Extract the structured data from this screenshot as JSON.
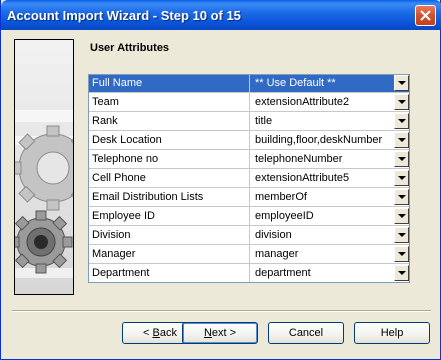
{
  "window": {
    "title": "Account Import Wizard - Step 10 of 15"
  },
  "page": {
    "section_title": "User Attributes"
  },
  "attributes": {
    "rows": [
      {
        "name": "Full Name",
        "value": "** Use Default **"
      },
      {
        "name": "Team",
        "value": "extensionAttribute2"
      },
      {
        "name": "Rank",
        "value": "title"
      },
      {
        "name": "Desk Location",
        "value": "building,floor,deskNumber"
      },
      {
        "name": "Telephone no",
        "value": "telephoneNumber"
      },
      {
        "name": "Cell Phone",
        "value": "extensionAttribute5"
      },
      {
        "name": "Email Distribution Lists",
        "value": "memberOf"
      },
      {
        "name": "Employee ID",
        "value": "employeeID"
      },
      {
        "name": "Division",
        "value": "division"
      },
      {
        "name": "Manager",
        "value": "manager"
      },
      {
        "name": "Department",
        "value": "department"
      }
    ],
    "selected_index": 0
  },
  "buttons": {
    "back_prefix": "< ",
    "back_key": "B",
    "back_rest": "ack",
    "next_key": "N",
    "next_rest": "ext >",
    "cancel": "Cancel",
    "help": "Help"
  },
  "icons": {
    "close": "close-icon",
    "side_graphic": "gears-graphic",
    "dropdown": "chevron-down-icon"
  },
  "colors": {
    "titlebar": "#0a55d8",
    "selection": "#316ac5",
    "dialog_bg": "#ece9d8"
  }
}
